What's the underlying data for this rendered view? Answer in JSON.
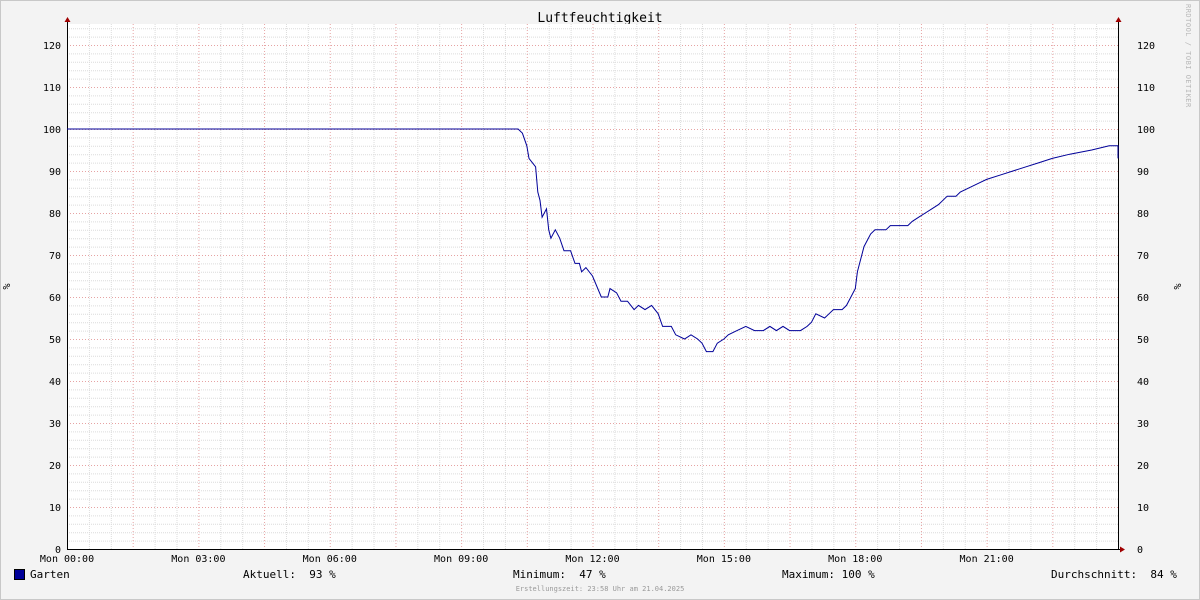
{
  "chart_data": {
    "type": "line",
    "title": "Luftfeuchtigkeit",
    "ylabel": "%",
    "ylim": [
      0,
      125
    ],
    "yticks": [
      0,
      10,
      20,
      30,
      40,
      50,
      60,
      70,
      80,
      90,
      100,
      110,
      120
    ],
    "xlim": [
      0,
      24
    ],
    "xticks": [
      {
        "h": 0,
        "label": "Mon 00:00"
      },
      {
        "h": 3,
        "label": "Mon 03:00"
      },
      {
        "h": 6,
        "label": "Mon 06:00"
      },
      {
        "h": 9,
        "label": "Mon 09:00"
      },
      {
        "h": 12,
        "label": "Mon 12:00"
      },
      {
        "h": 15,
        "label": "Mon 15:00"
      },
      {
        "h": 18,
        "label": "Mon 18:00"
      },
      {
        "h": 21,
        "label": "Mon 21:00"
      }
    ],
    "grid": true,
    "series": [
      {
        "name": "Garten",
        "color": "#000099",
        "points": [
          [
            0,
            100
          ],
          [
            10.3,
            100
          ],
          [
            10.4,
            99
          ],
          [
            10.5,
            96
          ],
          [
            10.55,
            93
          ],
          [
            10.7,
            91
          ],
          [
            10.75,
            85
          ],
          [
            10.8,
            83
          ],
          [
            10.85,
            79
          ],
          [
            10.95,
            81
          ],
          [
            11.0,
            76
          ],
          [
            11.05,
            74
          ],
          [
            11.15,
            76
          ],
          [
            11.25,
            74
          ],
          [
            11.35,
            71
          ],
          [
            11.5,
            71
          ],
          [
            11.6,
            68
          ],
          [
            11.7,
            68
          ],
          [
            11.75,
            66
          ],
          [
            11.85,
            67
          ],
          [
            12.0,
            65
          ],
          [
            12.2,
            60
          ],
          [
            12.35,
            60
          ],
          [
            12.4,
            62
          ],
          [
            12.55,
            61
          ],
          [
            12.65,
            59
          ],
          [
            12.8,
            59
          ],
          [
            12.95,
            57
          ],
          [
            13.05,
            58
          ],
          [
            13.2,
            57
          ],
          [
            13.35,
            58
          ],
          [
            13.5,
            56
          ],
          [
            13.6,
            53
          ],
          [
            13.8,
            53
          ],
          [
            13.9,
            51
          ],
          [
            14.1,
            50
          ],
          [
            14.25,
            51
          ],
          [
            14.4,
            50
          ],
          [
            14.5,
            49
          ],
          [
            14.6,
            47
          ],
          [
            14.75,
            47
          ],
          [
            14.85,
            49
          ],
          [
            15.0,
            50
          ],
          [
            15.1,
            51
          ],
          [
            15.3,
            52
          ],
          [
            15.5,
            53
          ],
          [
            15.7,
            52
          ],
          [
            15.9,
            52
          ],
          [
            16.05,
            53
          ],
          [
            16.2,
            52
          ],
          [
            16.35,
            53
          ],
          [
            16.5,
            52
          ],
          [
            16.75,
            52
          ],
          [
            16.9,
            53
          ],
          [
            17.0,
            54
          ],
          [
            17.1,
            56
          ],
          [
            17.3,
            55
          ],
          [
            17.4,
            56
          ],
          [
            17.5,
            57
          ],
          [
            17.7,
            57
          ],
          [
            17.8,
            58
          ],
          [
            17.9,
            60
          ],
          [
            18.0,
            62
          ],
          [
            18.05,
            66
          ],
          [
            18.1,
            68
          ],
          [
            18.2,
            72
          ],
          [
            18.35,
            75
          ],
          [
            18.45,
            76
          ],
          [
            18.7,
            76
          ],
          [
            18.8,
            77
          ],
          [
            19.2,
            77
          ],
          [
            19.3,
            78
          ],
          [
            19.45,
            79
          ],
          [
            19.6,
            80
          ],
          [
            19.75,
            81
          ],
          [
            19.9,
            82
          ],
          [
            20.1,
            84
          ],
          [
            20.3,
            84
          ],
          [
            20.4,
            85
          ],
          [
            20.6,
            86
          ],
          [
            20.8,
            87
          ],
          [
            21.0,
            88
          ],
          [
            21.3,
            89
          ],
          [
            21.6,
            90
          ],
          [
            21.9,
            91
          ],
          [
            22.2,
            92
          ],
          [
            22.5,
            93
          ],
          [
            22.9,
            94
          ],
          [
            23.4,
            95
          ],
          [
            23.8,
            96
          ],
          [
            24.0,
            96
          ],
          [
            24.25,
            95
          ],
          [
            24.5,
            94
          ],
          [
            24.7,
            94
          ],
          [
            24.75,
            93
          ]
        ]
      }
    ]
  },
  "legend": {
    "series_name": "Garten",
    "aktuell": "Aktuell:  93 %",
    "minimum": "Minimum:  47 %",
    "maximum": "Maximum: 100 %",
    "durchschnitt": "Durchschnitt:  84 %"
  },
  "watermark": "RRDTOOL / TOBI OETIKER",
  "footnote": "Erstellungszeit: 23:58 Uhr am 21.04.2025"
}
